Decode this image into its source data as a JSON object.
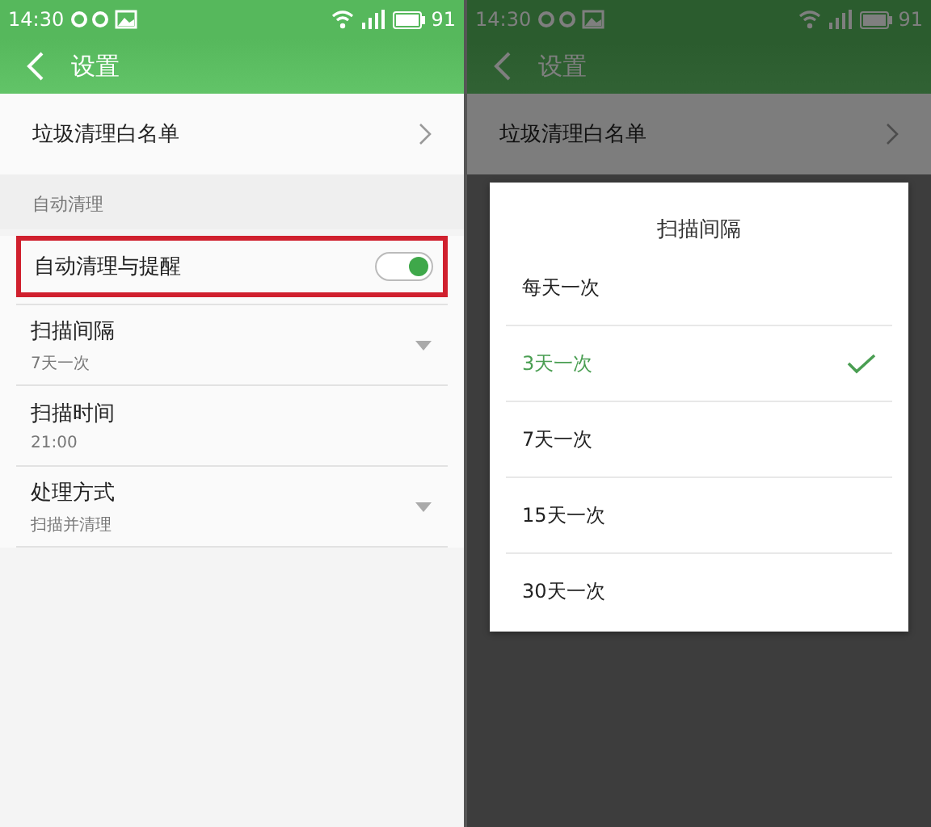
{
  "screens": [
    {
      "dimmed": false,
      "status_bar": {
        "time": "14:30",
        "battery": "91"
      },
      "app_bar": {
        "title": "设置"
      },
      "whitelist": {
        "label": "垃圾清理白名单"
      },
      "section": {
        "title": "自动清理"
      },
      "toggle": {
        "label": "自动清理与提醒",
        "on": true,
        "highlighted": true
      },
      "settings": [
        {
          "kind": "dropdown",
          "label": "扫描间隔",
          "value": "7天一次"
        },
        {
          "kind": "plain",
          "label": "扫描时间",
          "value": "21:00"
        },
        {
          "kind": "dropdown",
          "label": "处理方式",
          "value": "扫描并清理"
        }
      ]
    },
    {
      "dimmed": true,
      "status_bar": {
        "time": "14:30",
        "battery": "91"
      },
      "app_bar": {
        "title": "设置"
      },
      "whitelist": {
        "label": "垃圾清理白名单"
      },
      "dialog": {
        "title": "扫描间隔",
        "options": [
          {
            "label": "每天一次",
            "selected": false
          },
          {
            "label": "3天一次",
            "selected": true
          },
          {
            "label": "7天一次",
            "selected": false
          },
          {
            "label": "15天一次",
            "selected": false
          },
          {
            "label": "30天一次",
            "selected": false
          }
        ]
      }
    }
  ]
}
